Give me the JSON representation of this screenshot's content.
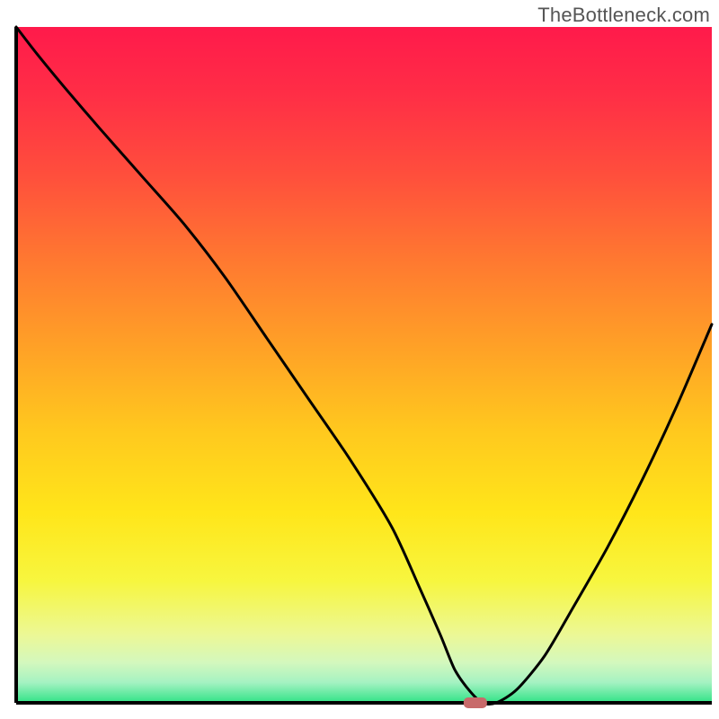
{
  "watermark": "TheBottleneck.com",
  "chart_data": {
    "type": "line",
    "title": "",
    "xlabel": "",
    "ylabel": "",
    "xlim": [
      0,
      100
    ],
    "ylim": [
      0,
      100
    ],
    "x": [
      0,
      3,
      7,
      12,
      18,
      24,
      30,
      36,
      42,
      48,
      54,
      58,
      61,
      63,
      65,
      67,
      69,
      72,
      76,
      80,
      85,
      90,
      95,
      100
    ],
    "values": [
      100,
      96,
      91,
      85,
      78,
      71,
      63,
      54,
      45,
      36,
      26,
      17,
      10,
      5,
      2,
      0,
      0,
      2,
      7,
      14,
      23,
      33,
      44,
      56
    ],
    "marker": {
      "x": 66,
      "y": 0,
      "color": "#c86a6a",
      "shape": "rounded-rect"
    },
    "gradient_stops": [
      {
        "offset": 0.0,
        "color": "#ff1a4b"
      },
      {
        "offset": 0.1,
        "color": "#ff2e46"
      },
      {
        "offset": 0.22,
        "color": "#ff4f3c"
      },
      {
        "offset": 0.35,
        "color": "#ff7a30"
      },
      {
        "offset": 0.48,
        "color": "#ffa326"
      },
      {
        "offset": 0.6,
        "color": "#ffc91e"
      },
      {
        "offset": 0.72,
        "color": "#ffe61a"
      },
      {
        "offset": 0.82,
        "color": "#f7f63f"
      },
      {
        "offset": 0.9,
        "color": "#ecf896"
      },
      {
        "offset": 0.94,
        "color": "#d4f8bd"
      },
      {
        "offset": 0.97,
        "color": "#a5f2c2"
      },
      {
        "offset": 1.0,
        "color": "#30e386"
      }
    ],
    "curve_color": "#000000",
    "axis_color": "#000000",
    "background_color": "#ffffff"
  }
}
